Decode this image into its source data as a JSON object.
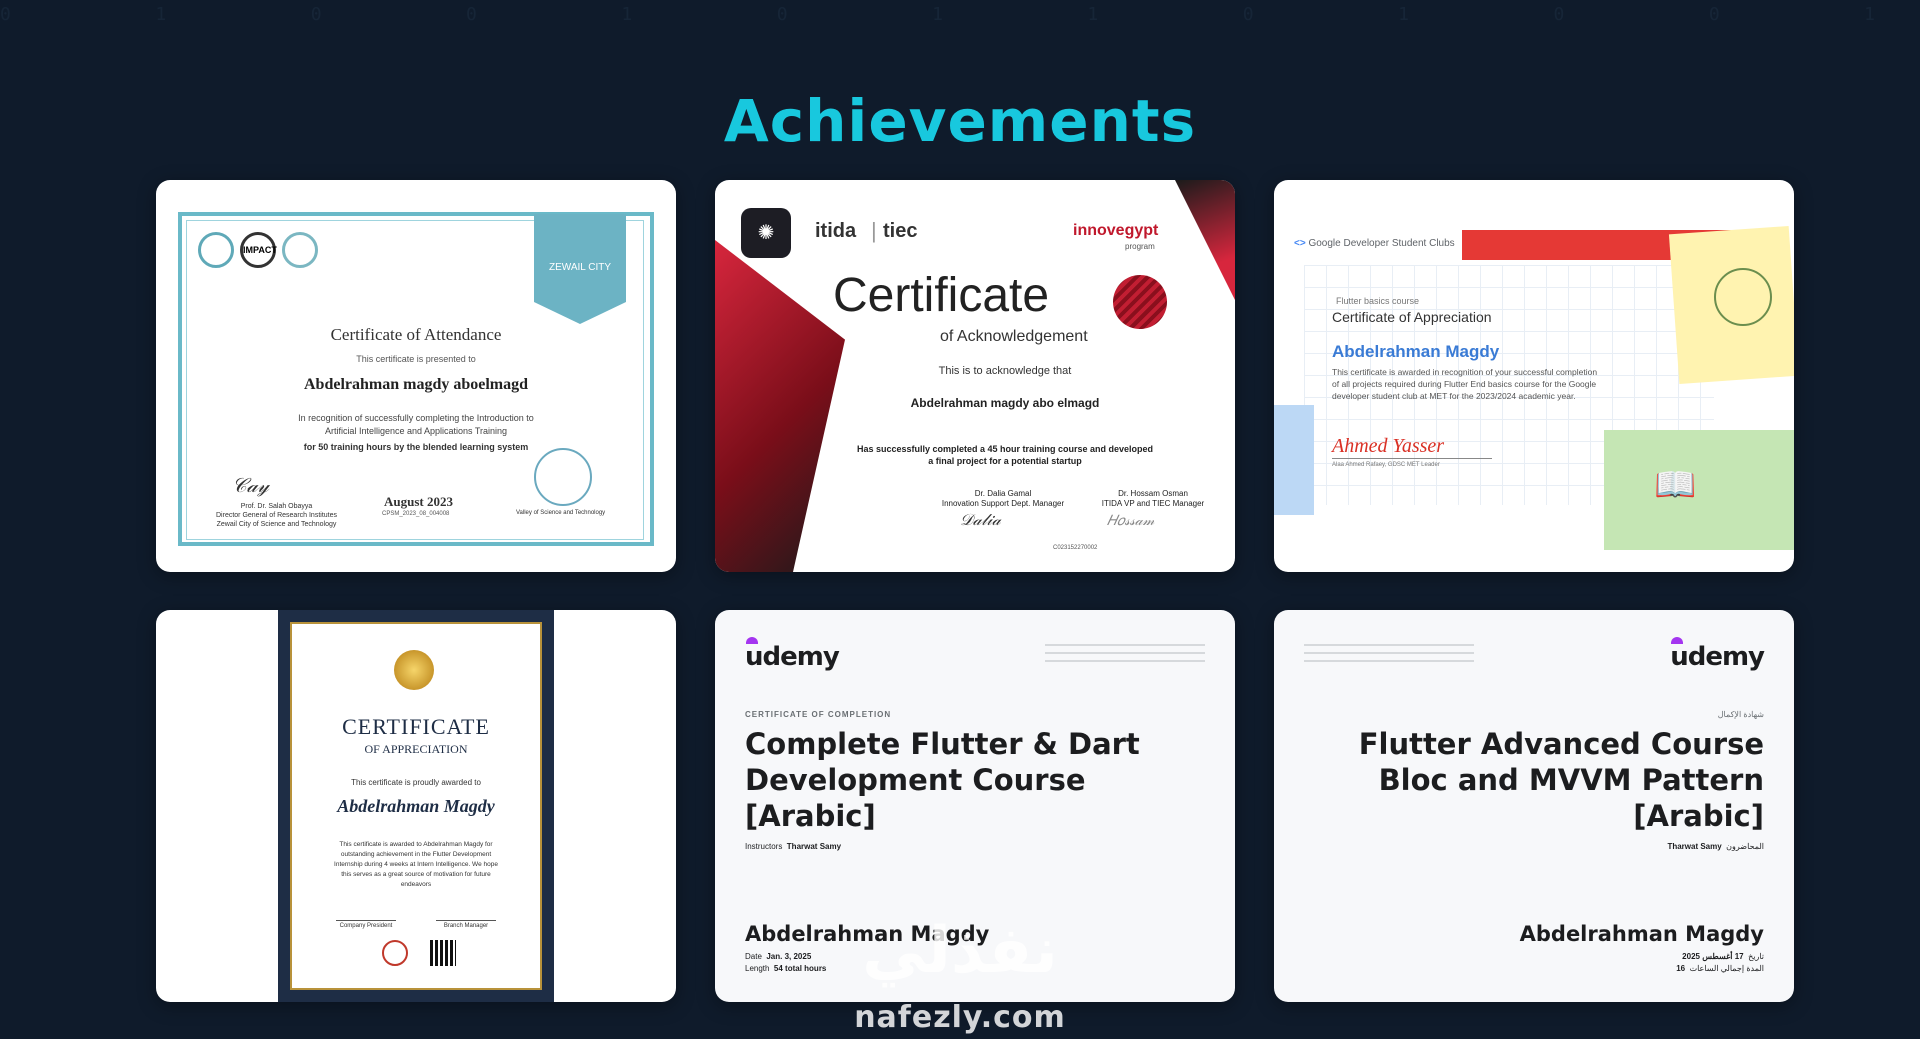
{
  "page": {
    "title": "Achievements",
    "accent": "#18c8de",
    "background": "#0f1b2b"
  },
  "certificates": [
    {
      "heading": "Certificate of Attendance",
      "presented": "This certificate is presented to",
      "recipient": "Abdelrahman magdy aboelmagd",
      "body1": "In recognition of successfully completing the Introduction to",
      "body2": "Artificial Intelligence and Applications Training",
      "hours": "for 50 training hours by the blended learning system",
      "date": "August 2023",
      "ref": "CPSM_2023_08_004008",
      "signer_name": "Prof. Dr. Salah Obayya",
      "signer_title1": "Director General of Research Institutes",
      "signer_title2": "Zewail City of Science and Technology",
      "seal_caption": "Valley of Science and Technology",
      "badge_text": "ZEWAIL CITY",
      "logo_text": "IMPACT"
    },
    {
      "brand1": "itida",
      "brand2": "tiec",
      "brand3": "innovegypt",
      "brand3_sub": "program",
      "heading": "Certificate",
      "subheading": "of Acknowledgement",
      "intro": "This is to acknowledge that",
      "recipient": "Abdelrahman magdy abo elmagd",
      "body1": "Has successfully completed a 45 hour training course and developed",
      "body2": "a final project for a potential startup",
      "sig1_name": "Dr. Dalia Gamal",
      "sig1_title": "Innovation Support Dept. Manager",
      "sig2_name": "Dr. Hossam Osman",
      "sig2_title": "ITIDA VP and TIEC Manager",
      "serial": "C023152270002"
    },
    {
      "org": "Google Developer Student Clubs",
      "course": "Flutter basics course",
      "heading": "Certificate of Appreciation",
      "recipient": "Abdelrahman Magdy",
      "body1": "This certificate is awarded in recognition of your successful completion",
      "body2": "of all projects required during Flutter End basics course for the Google",
      "body3": "developer student club at MET for the 2023/2024 academic year.",
      "signature": "Ahmed Yasser",
      "signer": "Alaa Ahmed Rafaey, GDSC MET Leader"
    },
    {
      "heading": "CERTIFICATE",
      "subheading": "OF APPRECIATION",
      "intro": "This certificate is proudly awarded to",
      "recipient": "Abdelrahman Magdy",
      "body1": "This certificate is awarded to Abdelrahman Magdy for",
      "body2": "outstanding achievement in the Flutter Development",
      "body3": "Internship during 4 weeks at Intern Intelligence. We hope",
      "body4": "this serves as a great source of motivation for future",
      "body5": "endeavors",
      "sig1": "Company President",
      "sig2": "Branch Manager"
    },
    {
      "brand": "udemy",
      "label": "CERTIFICATE OF COMPLETION",
      "title_line1": "Complete Flutter & Dart",
      "title_line2": "Development Course",
      "title_line3": "[Arabic]",
      "instructors_label": "Instructors",
      "instructor": "Tharwat Samy",
      "recipient": "Abdelrahman Magdy",
      "date_label": "Date",
      "date": "Jan. 3, 2025",
      "length_label": "Length",
      "length": "54 total hours"
    },
    {
      "brand": "udemy",
      "label": "شهادة الإكمال",
      "title_line1": "Flutter Advanced Course",
      "title_line2": "Bloc and MVVM Pattern",
      "title_line3": "[Arabic]",
      "instructors_label": "المحاضرون",
      "instructor": "Tharwat Samy",
      "recipient": "Abdelrahman Magdy",
      "date_label": "تاريخ",
      "date": "17 أغسطس 2025",
      "length_label": "المدة إجمالي الساعات",
      "length": "16"
    }
  ],
  "watermark": {
    "arabic": "نفذلي",
    "latin": "nafezly.com"
  }
}
